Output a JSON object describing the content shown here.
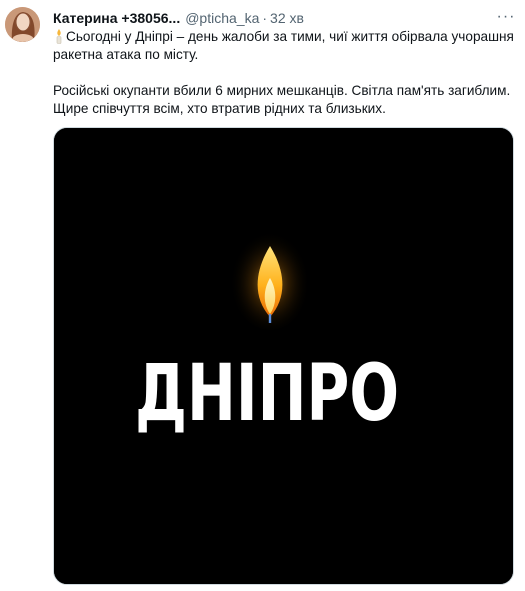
{
  "tweet": {
    "display_name": "Катерина +38056...",
    "handle": "@pticha_ka",
    "separator": "·",
    "time": "32 хв",
    "more_label": "···",
    "line1_text": "Сьогодні у Дніпрі – день жалоби за тими, чиї життя обірвала учорашня ракетна атака по місту.",
    "line2_text": "Російські окупанти вбили 6 мирних мешканців. Світла пам'ять загиблим. Щире співчуття всім, хто втратив рідних та близьких."
  },
  "media": {
    "image_text": "ДНІПРО",
    "background_color": "#000000",
    "text_color": "#ffffff",
    "flame_color": "#ffb21c"
  },
  "icons": {
    "candle": "candle-icon",
    "more": "more-icon",
    "flame": "flame-icon"
  }
}
